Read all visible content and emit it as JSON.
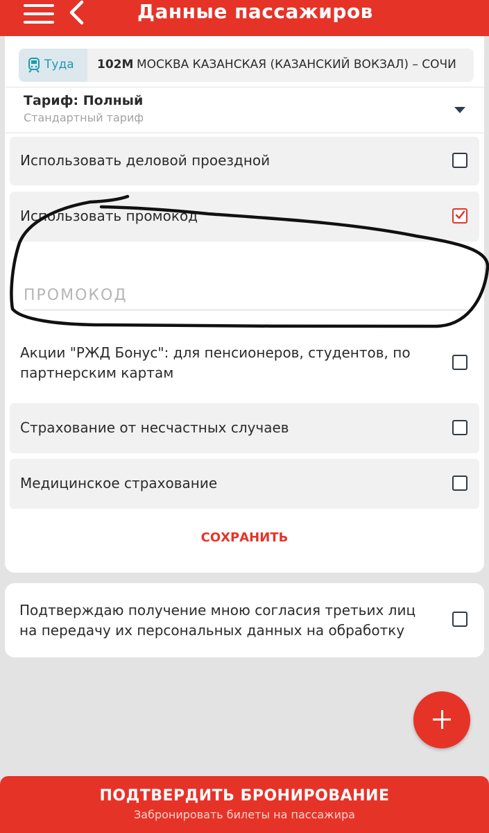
{
  "header": {
    "title": "Данные пассажиров",
    "menu_icon": "hamburger-menu-icon",
    "back_icon": "chevron-left-icon"
  },
  "route": {
    "direction_icon": "train-icon",
    "direction_label": "Туда",
    "train_number": "102М",
    "route_text": "МОСКВА КАЗАНСКАЯ (КАЗАНСКИЙ ВОКЗАЛ) – СОЧИ"
  },
  "tariff": {
    "label": "Тариф: Полный",
    "sublabel": "Стандартный тариф",
    "dropdown_icon": "caret-down-icon"
  },
  "options": [
    {
      "label": "Использовать деловой проездной",
      "checked": false
    },
    {
      "label": "Использовать промокод",
      "checked": true
    },
    {
      "label": "Акции \"РЖД Бонус\": для пенсионеров, студентов, по партнерским картам",
      "checked": false
    },
    {
      "label": "Страхование от несчастных случаев",
      "checked": false
    },
    {
      "label": "Медицинское страхование",
      "checked": false
    }
  ],
  "promo": {
    "placeholder": "ПРОМОКОД",
    "value": ""
  },
  "save_label": "СОХРАНИТЬ",
  "consent": {
    "label": "Подтверждаю получение мною согласия третьих лиц на передачу их персональных данных на обработку",
    "checked": false
  },
  "fab": {
    "icon": "plus-icon"
  },
  "confirm": {
    "title": "ПОДТВЕРДИТЬ БРОНИРОВАНИЕ",
    "subtitle": "Забронировать билеты на пассажира"
  },
  "colors": {
    "brand": "#e63328",
    "direction_accent": "#1c9ab0",
    "background": "#e3e3e3"
  }
}
